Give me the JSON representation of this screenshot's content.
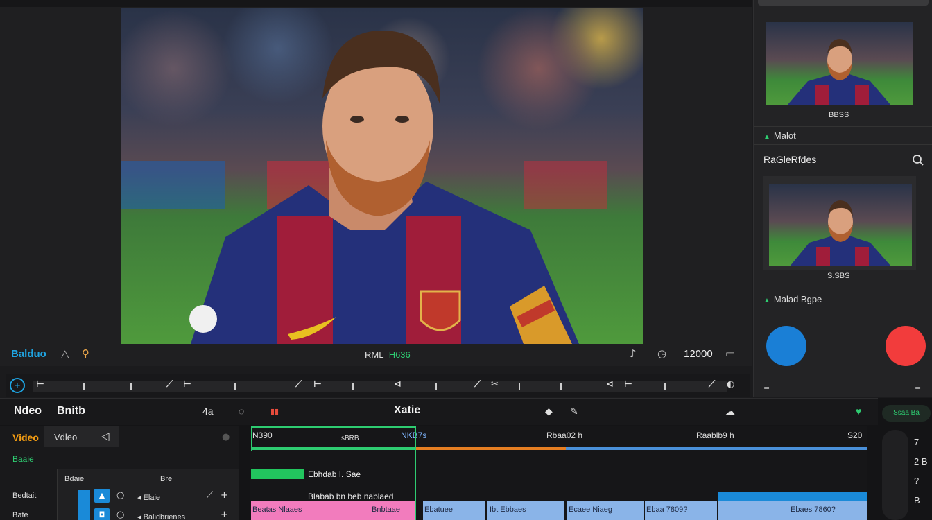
{
  "preview": {
    "project_label": "Balduo",
    "center_label_a": "RML",
    "center_label_b": "H636",
    "counter": "12000"
  },
  "side": {
    "thumb1_caption": "BBSS",
    "section1_label": "Malot",
    "heading": "RaGleRfdes",
    "thumb2_caption": "S.SBS",
    "section2_label": "Malad Bgpe",
    "circle_colors": {
      "left": "#1a7fd6",
      "right": "#f23c3c"
    }
  },
  "timeline": {
    "title_a": "Ndeo",
    "title_b": "Bnitb",
    "hdr_num": "4a",
    "center_title": "Xatie",
    "tab_video": "Video",
    "tab_video2": "Vdleo",
    "green_label": "Baaie",
    "track_cols": [
      "Bdaie",
      "Bre"
    ],
    "row_labels": [
      "Bedtait",
      "Bate"
    ],
    "row_names": [
      "Elaie",
      "Balidbrienes"
    ],
    "timecodes": [
      "N390",
      "NKB7s",
      "Rbaa02 h",
      "Raablb9 h",
      "S20"
    ],
    "sel_label": "sBRB",
    "clip_label_1": "Ebhdab I. Sae",
    "clip_label_2": "Blabab bn beb nablaed",
    "bottom_clips": [
      {
        "label": "Beatas  Nlaaes",
        "color": "#f27cbd"
      },
      {
        "label": "Bnbtaae",
        "color": "#f27cbd"
      },
      {
        "label": "Ebatuee",
        "color": "#8ab4e8"
      },
      {
        "label": "Ibt  Ebbaes",
        "color": "#8ab4e8"
      },
      {
        "label": "Ecaee  Niaeg",
        "color": "#8ab4e8"
      },
      {
        "label": "Ebaa  7809?",
        "color": "#8ab4e8"
      },
      {
        "label": "Ebaes  7860?",
        "color": "#8ab4e8"
      }
    ],
    "right_badge": "Ssaa Ba",
    "right_nums": [
      "7",
      "2 B",
      "?",
      "B"
    ]
  }
}
